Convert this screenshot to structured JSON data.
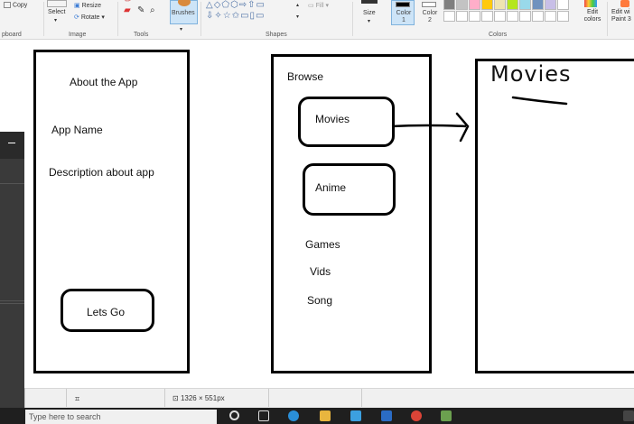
{
  "ribbon": {
    "clipboard": {
      "copy_label": "Copy",
      "group_label": "pboard"
    },
    "image": {
      "select_label": "Select",
      "resize_label": "Resize",
      "rotate_label": "Rotate ▾",
      "group_label": "Image"
    },
    "tools": {
      "group_label": "Tools"
    },
    "brushes_label": "Brushes",
    "shapes": {
      "glyphs_row1": "△◇⬠⬡⇨⇧▭",
      "glyphs_row2": "⇩✧☆✩▭▯▭",
      "fill_label": "Fill ▾",
      "group_label": "Shapes"
    },
    "size_label": "Size",
    "color1_label": "Color 1",
    "color2_label": "Color 2",
    "colors_group_label": "Colors",
    "edit_colors_label": "Edit colors",
    "edit_paint3d_label": "Edit wi Paint 3",
    "palette_row1": [
      "#7f7f7f",
      "#c3c3c3",
      "#ffaec9",
      "#ffc90e",
      "#efe4b0",
      "#b5e61d",
      "#99d9ea",
      "#7092be",
      "#c8bfe7",
      "#ffffff"
    ],
    "palette_row2": [
      "#ffffff",
      "#ffffff",
      "#ffffff",
      "#ffffff",
      "#ffffff",
      "#ffffff",
      "#ffffff",
      "#ffffff",
      "#ffffff",
      "#ffffff"
    ],
    "color1": "#000000",
    "color2": "#ffffff"
  },
  "canvas": {
    "screen1": {
      "title": "About the App",
      "app_name": "App Name",
      "description": "Description about app",
      "button": "Lets Go"
    },
    "screen2": {
      "title": "Browse",
      "items_boxed": [
        "Movies",
        "Anime"
      ],
      "items_plain": [
        "Games",
        "Vids",
        "Song"
      ]
    },
    "screen3": {
      "title": "Movies"
    }
  },
  "status": {
    "dimensions": "1326 × 551px"
  },
  "taskbar": {
    "search_placeholder": "Type here to search"
  }
}
